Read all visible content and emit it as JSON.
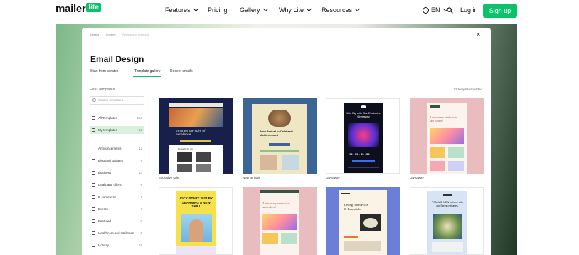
{
  "nav": {
    "logo_text": "mailer",
    "logo_badge": "lite",
    "links": [
      {
        "label": "Features",
        "has_chevron": true
      },
      {
        "label": "Pricing",
        "has_chevron": false
      },
      {
        "label": "Gallery",
        "has_chevron": true
      },
      {
        "label": "Why Lite",
        "has_chevron": true
      },
      {
        "label": "Resources",
        "has_chevron": true
      }
    ],
    "language": "EN",
    "login": "Log in",
    "signup": "Sign up",
    "accent_color": "#09c269"
  },
  "modal": {
    "breadcrumb": [
      "Details",
      "Content",
      "Review and schedule"
    ],
    "title": "Email Design",
    "tabs": [
      "Start from scratch",
      "Template gallery",
      "Recent emails"
    ],
    "active_tab": "Template gallery",
    "filter_label": "Filter Templates",
    "templates_count": "72 templates loaded",
    "search_placeholder": "Search templates",
    "sidebar_primary": [
      {
        "label": "All Templates",
        "count": "123"
      },
      {
        "label": "My templates",
        "count": "12"
      }
    ],
    "sidebar_categories": [
      {
        "label": "Announcements",
        "count": "12"
      },
      {
        "label": "Blog and updates",
        "count": "9"
      },
      {
        "label": "Business",
        "count": "13"
      },
      {
        "label": "Deals and offers",
        "count": "8"
      },
      {
        "label": "E-commerce",
        "count": "9"
      },
      {
        "label": "Events",
        "count": "7"
      },
      {
        "label": "Featured",
        "count": "9"
      },
      {
        "label": "Healthcare and Wellness",
        "count": "6"
      },
      {
        "label": "Holiday",
        "count": "19"
      }
    ]
  },
  "cards": [
    {
      "label": "Exclusive sale",
      "headline": "Embrace the spirit of excellence",
      "sub": "Rewards for you"
    },
    {
      "label": "New arrivals",
      "headline": "New Arrival to Celebrate Achievement"
    },
    {
      "label": "Giveaway",
      "headline": "Win Big with Our Exclusive Giveaway",
      "timer": "23 : 55 : 55 : 55"
    },
    {
      "label": "Giveaway",
      "headline": "Anniversary celebration sale is here!"
    },
    {
      "label": "",
      "headline": "KICK-START 2024 BY LEARNING A NEW SKILL"
    },
    {
      "label": "",
      "headline": "Anniversary celebration sale is here!"
    },
    {
      "label": "",
      "headline": "Living room Picks & Essentials"
    },
    {
      "label": "",
      "headline": "PSALMS: NEW In Love with our Spring releases."
    }
  ]
}
